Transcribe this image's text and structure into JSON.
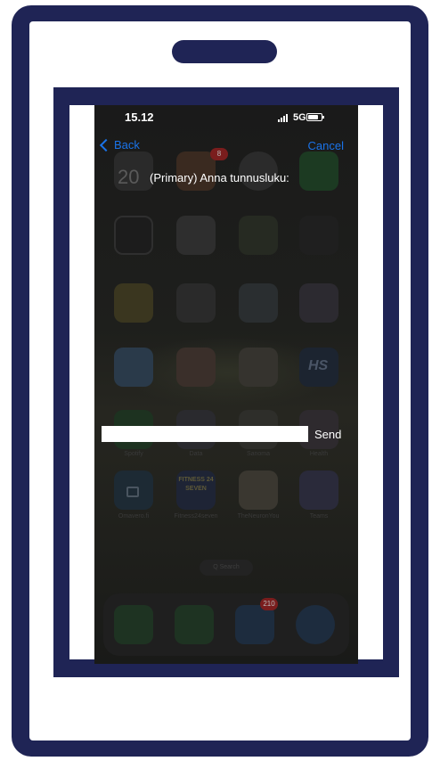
{
  "status": {
    "time": "15.12",
    "network": "5G"
  },
  "nav": {
    "back_label": "Back",
    "cancel_label": "Cancel"
  },
  "prompt": {
    "text": "(Primary) Anna tunnusluku:"
  },
  "input": {
    "value": "",
    "placeholder": ""
  },
  "send_label": "Send",
  "background_apps": {
    "calendar_day": "20",
    "badge_photos": "8",
    "hs_label": "HS",
    "fitness_text": "FITNESS 24 SEVEN",
    "mail_badge": "210",
    "search_label": "Q Search",
    "labels": [
      "Spotify",
      "Data",
      "Sanoma",
      "Health",
      "Omavero.fi",
      "Fitness24seven",
      "TheNeuronYou",
      "Teams"
    ]
  },
  "colors": {
    "frame": "#1f2455",
    "link": "#1a73e8",
    "screen_bg": "#141414"
  }
}
